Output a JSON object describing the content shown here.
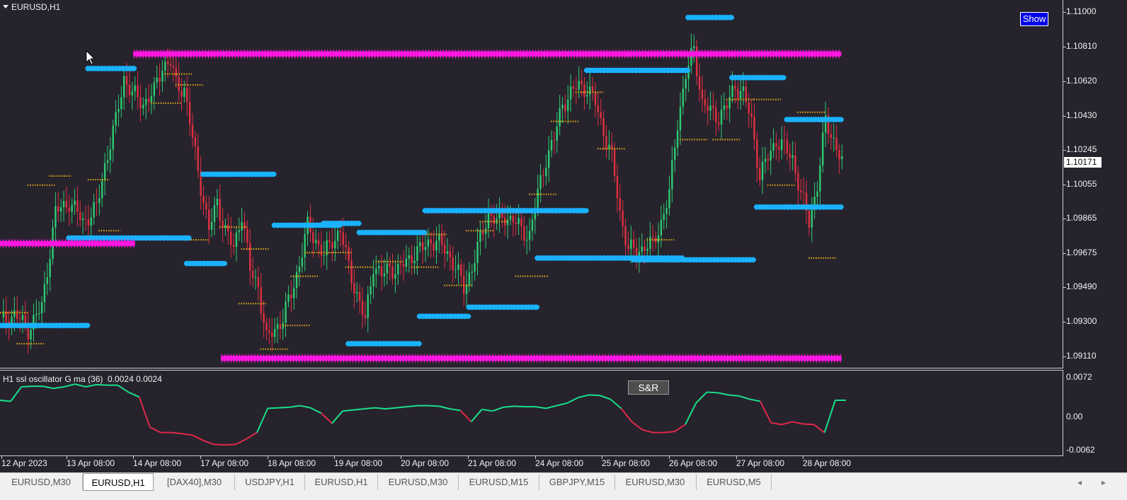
{
  "chart": {
    "title": "EURUSD,H1",
    "show_button": "Show",
    "current_price": "1.10171",
    "price_axis": [
      "1.11000",
      "1.10810",
      "1.10620",
      "1.10430",
      "1.10245",
      "1.10055",
      "1.09865",
      "1.09675",
      "1.09490",
      "1.09300",
      "1.09110"
    ],
    "time_axis": [
      "12 Apr 2023",
      "13 Apr 08:00",
      "14 Apr 08:00",
      "17 Apr 08:00",
      "18 Apr 08:00",
      "19 Apr 08:00",
      "20 Apr 08:00",
      "21 Apr 08:00",
      "24 Apr 08:00",
      "25 Apr 08:00",
      "26 Apr 08:00",
      "27 Apr 08:00",
      "28 Apr 08:00"
    ],
    "colors": {
      "background": "#26232d",
      "bull_candle": "#2ecc71",
      "bear_candle": "#e03040",
      "support_resistance": "#1ab2ff",
      "major_level": "#ff16e0",
      "dots": "#d4a017"
    }
  },
  "oscillator": {
    "title": "H1 ssl oscillator G ma (36)  0.0024 0.0024",
    "sr_button": "S&R",
    "axis": [
      "0.0072",
      "0.00",
      "-0.0062"
    ],
    "colors": {
      "positive": "#19e08a",
      "negative": "#e0284a"
    }
  },
  "chart_data": [
    {
      "type": "candlestick",
      "title": "EURUSD,H1",
      "ylim": [
        1.0905,
        1.1105
      ],
      "y_ticks": [
        1.11,
        1.1081,
        1.1062,
        1.1043,
        1.10245,
        1.10055,
        1.09865,
        1.09675,
        1.0949,
        1.093,
        1.0911
      ],
      "x_ticks": [
        "12 Apr 2023",
        "13 Apr 08:00",
        "14 Apr 08:00",
        "17 Apr 08:00",
        "18 Apr 08:00",
        "19 Apr 08:00",
        "20 Apr 08:00",
        "21 Apr 08:00",
        "24 Apr 08:00",
        "25 Apr 08:00",
        "26 Apr 08:00",
        "27 Apr 08:00",
        "28 Apr 08:00"
      ],
      "close_path": [
        [
          0,
          1.093
        ],
        [
          5,
          1.0934
        ],
        [
          10,
          1.0926
        ],
        [
          15,
          1.0938
        ],
        [
          20,
          1.099
        ],
        [
          25,
          1.0996
        ],
        [
          30,
          1.0985
        ],
        [
          35,
          1.0992
        ],
        [
          38,
          1.1016
        ],
        [
          42,
          1.104
        ],
        [
          45,
          1.1064
        ],
        [
          48,
          1.1055
        ],
        [
          52,
          1.105
        ],
        [
          56,
          1.1056
        ],
        [
          59,
          1.1071
        ],
        [
          62,
          1.1072
        ],
        [
          64,
          1.106
        ],
        [
          67,
          1.1058
        ],
        [
          70,
          1.103
        ],
        [
          73,
          1.1005
        ],
        [
          76,
          1.098
        ],
        [
          79,
          1.0996
        ],
        [
          82,
          1.098
        ],
        [
          85,
          1.097
        ],
        [
          88,
          1.099
        ],
        [
          91,
          1.0958
        ],
        [
          94,
          1.095
        ],
        [
          97,
          1.092
        ],
        [
          100,
          1.0926
        ],
        [
          103,
          1.0932
        ],
        [
          106,
          1.0945
        ],
        [
          109,
          1.0962
        ],
        [
          112,
          1.0982
        ],
        [
          115,
          1.0975
        ],
        [
          118,
          1.0966
        ],
        [
          121,
          1.0975
        ],
        [
          124,
          1.098
        ],
        [
          127,
          1.096
        ],
        [
          130,
          1.0945
        ],
        [
          133,
          1.093
        ],
        [
          136,
          1.0962
        ],
        [
          139,
          1.0955
        ],
        [
          142,
          1.096
        ],
        [
          145,
          1.0958
        ],
        [
          148,
          1.0963
        ],
        [
          151,
          1.0968
        ],
        [
          154,
          1.097
        ],
        [
          157,
          1.0975
        ],
        [
          160,
          1.0973
        ],
        [
          163,
          1.0968
        ],
        [
          166,
          1.096
        ],
        [
          169,
          1.0948
        ],
        [
          172,
          1.096
        ],
        [
          175,
          1.0975
        ],
        [
          178,
          1.099
        ],
        [
          181,
          1.0985
        ],
        [
          184,
          1.0988
        ],
        [
          187,
          1.0986
        ],
        [
          190,
          1.098
        ],
        [
          193,
          1.0978
        ],
        [
          196,
          1.1
        ],
        [
          199,
          1.102
        ],
        [
          202,
          1.103
        ],
        [
          205,
          1.105
        ],
        [
          208,
          1.1055
        ],
        [
          211,
          1.106
        ],
        [
          214,
          1.1058
        ],
        [
          217,
          1.105
        ],
        [
          220,
          1.1035
        ],
        [
          223,
          1.102
        ],
        [
          226,
          1.099
        ],
        [
          229,
          1.097
        ],
        [
          232,
          1.0968
        ],
        [
          235,
          1.0972
        ],
        [
          238,
          1.0972
        ],
        [
          241,
          1.0985
        ],
        [
          244,
          1.1
        ],
        [
          247,
          1.104
        ],
        [
          250,
          1.1065
        ],
        [
          253,
          1.108
        ],
        [
          256,
          1.105
        ],
        [
          259,
          1.1045
        ],
        [
          262,
          1.1043
        ],
        [
          265,
          1.1048
        ],
        [
          268,
          1.106
        ],
        [
          271,
          1.1055
        ],
        [
          274,
          1.104
        ],
        [
          277,
          1.101
        ],
        [
          280,
          1.102
        ],
        [
          283,
          1.103
        ],
        [
          286,
          1.1025
        ],
        [
          289,
          1.102
        ],
        [
          292,
          1.1
        ],
        [
          295,
          1.0985
        ],
        [
          298,
          1.1005
        ],
        [
          301,
          1.104
        ],
        [
          304,
          1.103
        ],
        [
          307,
          1.1017
        ]
      ]
    },
    {
      "type": "line",
      "title": "H1 ssl oscillator G ma (36)",
      "ylim": [
        -0.0062,
        0.0072
      ],
      "y_ticks": [
        0.0072,
        0.0,
        -0.0062
      ],
      "values": [
        0.003,
        0.0028,
        0.0055,
        0.0056,
        0.0056,
        0.0052,
        0.0055,
        0.006,
        0.0055,
        0.0059,
        0.0058,
        0.0058,
        0.0045,
        0.0036,
        -0.002,
        -0.003,
        -0.003,
        -0.0032,
        -0.0035,
        -0.0045,
        -0.0052,
        -0.0053,
        -0.0052,
        -0.0042,
        -0.003,
        0.0015,
        0.0016,
        0.0017,
        0.002,
        0.0016,
        0.0006,
        -0.0013,
        0.001,
        0.0012,
        0.0014,
        0.0016,
        0.0014,
        0.0016,
        0.0018,
        0.002,
        0.002,
        0.0019,
        0.0014,
        0.0011,
        -0.001,
        0.0013,
        0.001,
        0.0017,
        0.0019,
        0.0018,
        0.0018,
        0.0015,
        0.002,
        0.0025,
        0.0035,
        0.004,
        0.0039,
        0.0032,
        0.0015,
        -0.001,
        -0.0025,
        -0.003,
        -0.003,
        -0.0028,
        -0.0015,
        0.0025,
        0.0045,
        0.0044,
        0.004,
        0.0038,
        0.0032,
        0.0028,
        -0.0012,
        -0.0015,
        -0.001,
        -0.0014,
        -0.0015,
        -0.003,
        0.003,
        0.003
      ],
      "sign_colored": true
    }
  ],
  "tabs": [
    {
      "label": "EURUSD,M30",
      "active": false
    },
    {
      "label": "EURUSD,H1",
      "active": true
    },
    {
      "label": "[DAX40],M30",
      "active": false
    },
    {
      "label": "USDJPY,H1",
      "active": false
    },
    {
      "label": "EURUSD,H1",
      "active": false
    },
    {
      "label": "EURUSD,M30",
      "active": false
    },
    {
      "label": "EURUSD,M15",
      "active": false
    },
    {
      "label": "GBPJPY,M15",
      "active": false
    },
    {
      "label": "EURUSD,M30",
      "active": false
    },
    {
      "label": "EURUSD,M5",
      "active": false
    }
  ],
  "scroll": {
    "left": "◂",
    "right": "▸"
  }
}
